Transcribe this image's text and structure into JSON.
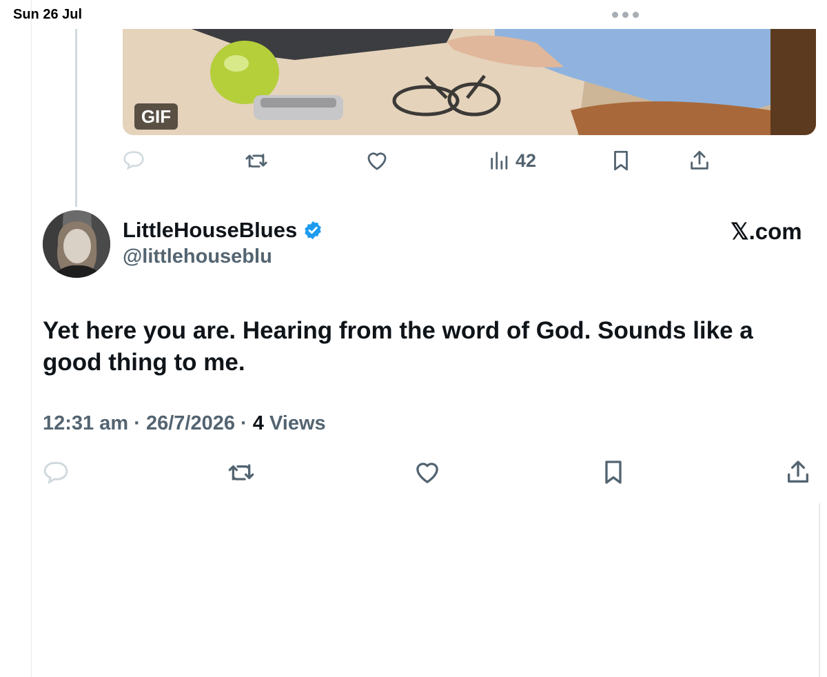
{
  "status_bar": {
    "date": "Sun 26 Jul"
  },
  "gif_post": {
    "badge": "GIF",
    "views_count": "42"
  },
  "reply": {
    "display_name": "LittleHouseBlues",
    "handle": "@littlehouseblu",
    "source": "𝕏.com",
    "text": "Yet here you are. Hearing from the word of God. Sounds like a good thing to me.",
    "time": "12:31 am",
    "date": "26/7/2026",
    "separator": "·",
    "views_count": "4",
    "views_label": "Views",
    "verified": true
  },
  "colors": {
    "accent": "#1d9bf0",
    "muted": "#536471",
    "text": "#0f1419",
    "thread_line": "#cfd9de"
  },
  "icons": [
    "reply-icon",
    "retweet-icon",
    "like-icon",
    "views-icon",
    "bookmark-icon",
    "share-icon",
    "verified-badge-icon",
    "more-icon"
  ]
}
